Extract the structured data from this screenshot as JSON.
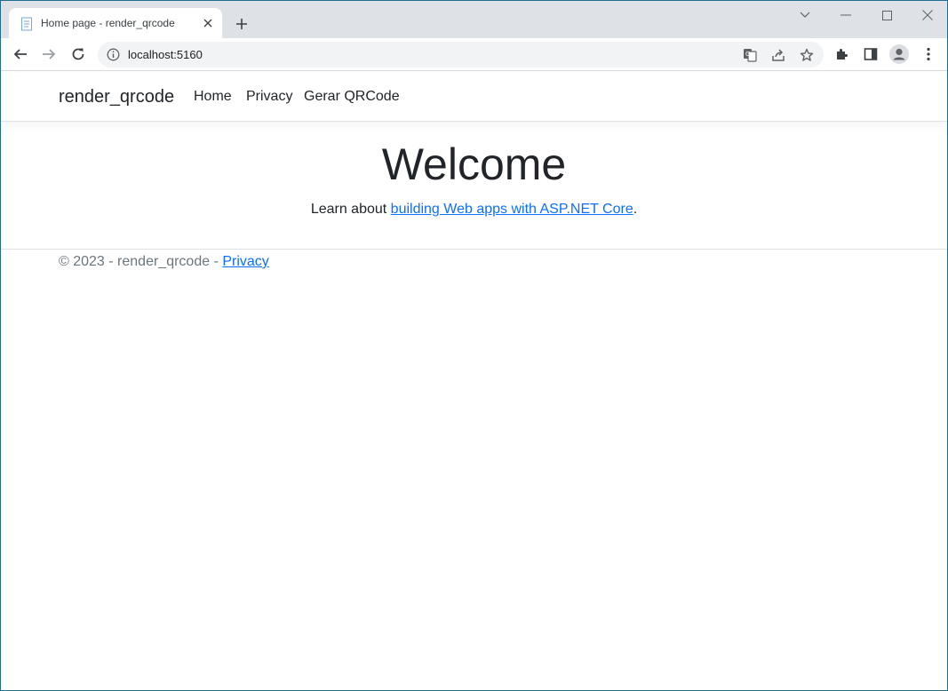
{
  "browser": {
    "tab_title": "Home page - render_qrcode",
    "url": "localhost:5160"
  },
  "navbar": {
    "brand": "render_qrcode",
    "links": [
      "Home",
      "Privacy",
      "Gerar QRCode"
    ]
  },
  "main": {
    "heading": "Welcome",
    "learn_prefix": "Learn about ",
    "learn_link": "building Web apps with ASP.NET Core",
    "learn_suffix": "."
  },
  "footer": {
    "text": "© 2023 - render_qrcode - ",
    "privacy_link": "Privacy"
  },
  "colors": {
    "link": "#0d6efd",
    "tabstrip": "#dee1e6",
    "omnibox": "#f1f3f4"
  },
  "icons": {
    "tab_favicon": "page-icon",
    "tab_close": "close-icon",
    "new_tab": "plus-icon",
    "back": "back-arrow-icon",
    "forward": "forward-arrow-icon",
    "reload": "reload-icon",
    "site_info": "info-icon",
    "translate": "translate-icon",
    "share": "share-icon",
    "bookmark": "star-icon",
    "extensions": "puzzle-icon",
    "side_panel": "side-panel-icon",
    "profile": "avatar-icon",
    "menu": "kebab-menu-icon"
  }
}
